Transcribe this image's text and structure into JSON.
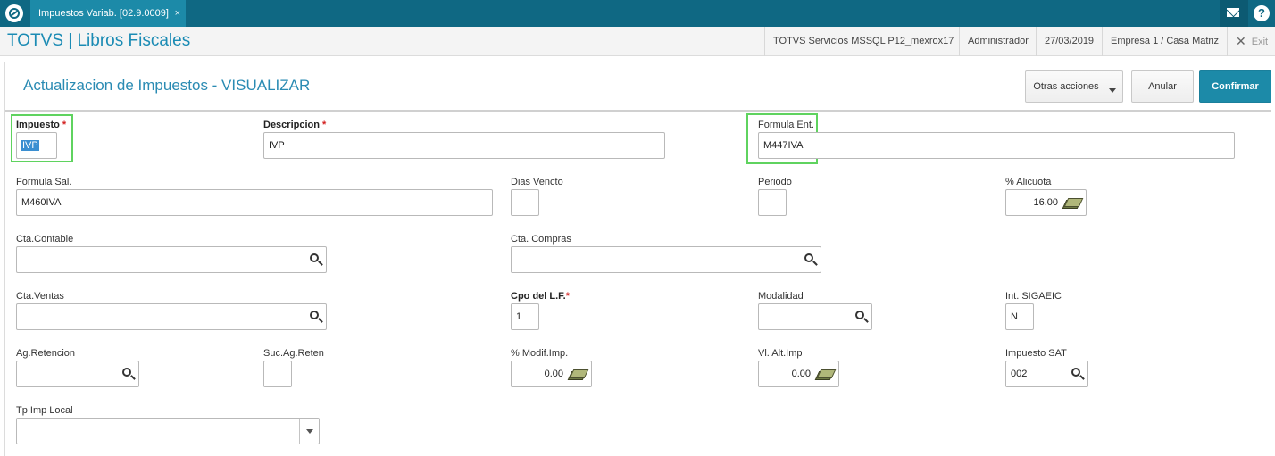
{
  "topbar": {
    "tab_label": "Impuestos Variab. [02.9.0009]",
    "tab_close": "×",
    "help_label": "?"
  },
  "appbar": {
    "title": "TOTVS | Libros Fiscales",
    "server": "TOTVS Servicios MSSQL P12_mexrox17",
    "user": "Administrador",
    "date": "27/03/2019",
    "company": "Empresa 1 / Casa Matriz",
    "exit_label": "Exit"
  },
  "form": {
    "title": "Actualizacion de Impuestos - VISUALIZAR",
    "buttons": {
      "otras": "Otras acciones",
      "anular": "Anular",
      "confirmar": "Confirmar"
    },
    "required_mark": "*",
    "fields": {
      "impuesto": {
        "label": "Impuesto",
        "value": "IVP"
      },
      "descripcion": {
        "label": "Descripcion",
        "value": "IVP"
      },
      "formula_ent": {
        "label": "Formula Ent.",
        "value": "M447IVA"
      },
      "formula_sal": {
        "label": "Formula Sal.",
        "value": "M460IVA"
      },
      "dias_vencto": {
        "label": "Dias Vencto",
        "value": ""
      },
      "periodo": {
        "label": "Periodo",
        "value": ""
      },
      "alicuota": {
        "label": "% Alicuota",
        "value": "16.00"
      },
      "cta_contable": {
        "label": "Cta.Contable",
        "value": ""
      },
      "cta_compras": {
        "label": "Cta. Compras",
        "value": ""
      },
      "cta_ventas": {
        "label": "Cta.Ventas",
        "value": ""
      },
      "cpo_lf": {
        "label": "Cpo del L.F.",
        "value": "1"
      },
      "modalidad": {
        "label": "Modalidad",
        "value": ""
      },
      "int_sigaeic": {
        "label": "Int. SIGAEIC",
        "value": "N"
      },
      "ag_retencion": {
        "label": "Ag.Retencion",
        "value": ""
      },
      "suc_ag_reten": {
        "label": "Suc.Ag.Reten",
        "value": ""
      },
      "modif_imp": {
        "label": "% Modif.Imp.",
        "value": "0.00"
      },
      "vl_alt_imp": {
        "label": "Vl. Alt.Imp",
        "value": "0.00"
      },
      "impuesto_sat": {
        "label": "Impuesto SAT",
        "value": "002"
      },
      "tp_imp_local": {
        "label": "Tp Imp Local",
        "value": ""
      }
    }
  },
  "colors": {
    "topbar": "#0f6883",
    "tab": "#1c8aa8",
    "title": "#1b8bb4",
    "confirm": "#1c8aa8",
    "highlight": "#5fd35f",
    "required": "#d32020"
  }
}
